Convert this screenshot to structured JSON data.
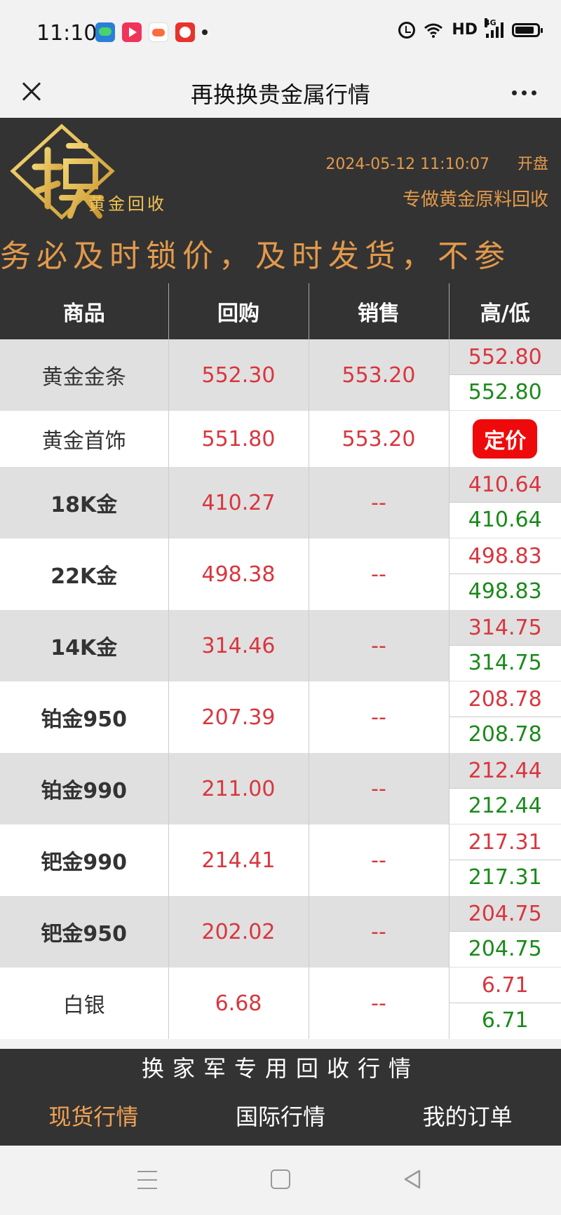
{
  "status": {
    "time": "11:10",
    "network": "HD",
    "signal_tag": "4G"
  },
  "titlebar": {
    "title": "再换换贵金属行情"
  },
  "header": {
    "logo_sub": "黄金回收",
    "datetime": "2024-05-12 11:10:07",
    "market_status": "开盘",
    "tagline": "专做黄金原料回收",
    "marquee": "务必及时锁价，及时发货，不参"
  },
  "table": {
    "headers": [
      "商品",
      "回购",
      "销售",
      "高/低"
    ],
    "rows": [
      {
        "name": "黄金金条",
        "buy": "552.30",
        "sell": "553.20",
        "high": "552.80",
        "low": "552.80"
      },
      {
        "name": "黄金首饰",
        "buy": "551.80",
        "sell": "553.20",
        "action": "定价"
      },
      {
        "name": "18K金",
        "buy": "410.27",
        "sell": "--",
        "high": "410.64",
        "low": "410.64"
      },
      {
        "name": "22K金",
        "buy": "498.38",
        "sell": "--",
        "high": "498.83",
        "low": "498.83"
      },
      {
        "name": "14K金",
        "buy": "314.46",
        "sell": "--",
        "high": "314.75",
        "low": "314.75"
      },
      {
        "name": "铂金950",
        "buy": "207.39",
        "sell": "--",
        "high": "208.78",
        "low": "208.78"
      },
      {
        "name": "铂金990",
        "buy": "211.00",
        "sell": "--",
        "high": "212.44",
        "low": "212.44"
      },
      {
        "name": "钯金990",
        "buy": "214.41",
        "sell": "--",
        "high": "217.31",
        "low": "217.31"
      },
      {
        "name": "钯金950",
        "buy": "202.02",
        "sell": "--",
        "high": "204.75",
        "low": "204.75"
      },
      {
        "name": "白银",
        "buy": "6.68",
        "sell": "--",
        "high": "6.71",
        "low": "6.71"
      }
    ]
  },
  "footer": {
    "caption": "换家军专用回收行情",
    "tabs": [
      {
        "label": "现货行情",
        "active": true
      },
      {
        "label": "国际行情",
        "active": false
      },
      {
        "label": "我的订单",
        "active": false
      }
    ]
  },
  "colors": {
    "accent": "#e39a4b",
    "header_bg": "#333333",
    "up_red": "#d9363e",
    "down_green": "#1a8a1a"
  }
}
